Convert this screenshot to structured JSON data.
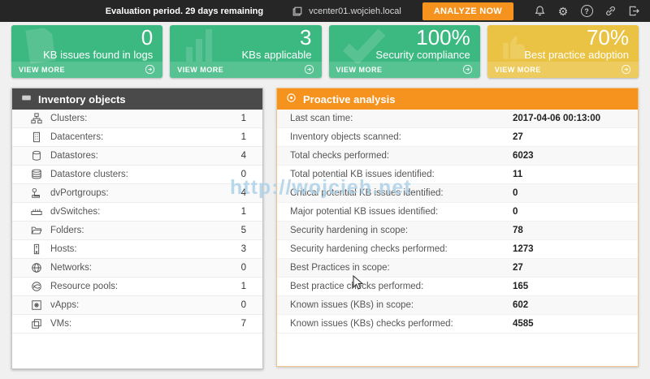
{
  "topbar": {
    "evaluation_text": "Evaluation period. 29 days remaining",
    "vcenter_host": "vcenter01.wojcieh.local",
    "analyze_button": "ANALYZE NOW",
    "icons": [
      "host-icon",
      "bell-icon",
      "gear-icon",
      "help-icon",
      "link-icon",
      "sign-out-icon"
    ]
  },
  "cards": [
    {
      "value": "0",
      "label": "KB issues found in logs",
      "view_more": "VIEW MORE",
      "color": "#3cb881",
      "bg_icon": "document-icon"
    },
    {
      "value": "3",
      "label": "KBs applicable",
      "view_more": "VIEW MORE",
      "color": "#3cb881",
      "bg_icon": "bar-chart-icon"
    },
    {
      "value": "100%",
      "label": "Security compliance",
      "view_more": "VIEW MORE",
      "color": "#3cb881",
      "bg_icon": "checkmark-icon"
    },
    {
      "value": "70%",
      "label": "Best practice adoption",
      "view_more": "VIEW MORE",
      "color": "#eac344",
      "bg_icon": "thumbs-up-icon"
    }
  ],
  "inventory": {
    "title": "Inventory objects",
    "rows": [
      {
        "icon": "clusters-icon",
        "label": "Clusters:",
        "value": "1"
      },
      {
        "icon": "datacenters-icon",
        "label": "Datacenters:",
        "value": "1"
      },
      {
        "icon": "datastores-icon",
        "label": "Datastores:",
        "value": "4"
      },
      {
        "icon": "datastore-clusters-icon",
        "label": "Datastore clusters:",
        "value": "0"
      },
      {
        "icon": "dvportgroups-icon",
        "label": "dvPortgroups:",
        "value": "4"
      },
      {
        "icon": "dvswitches-icon",
        "label": "dvSwitches:",
        "value": "1"
      },
      {
        "icon": "folders-icon",
        "label": "Folders:",
        "value": "5"
      },
      {
        "icon": "hosts-icon",
        "label": "Hosts:",
        "value": "3"
      },
      {
        "icon": "networks-icon",
        "label": "Networks:",
        "value": "0"
      },
      {
        "icon": "resource-pools-icon",
        "label": "Resource pools:",
        "value": "1"
      },
      {
        "icon": "vapps-icon",
        "label": "vApps:",
        "value": "0"
      },
      {
        "icon": "vms-icon",
        "label": "VMs:",
        "value": "7"
      }
    ]
  },
  "analysis": {
    "title": "Proactive analysis",
    "rows": [
      {
        "label": "Last scan time:",
        "value": "2017-04-06 00:13:00"
      },
      {
        "label": "Inventory objects scanned:",
        "value": "27"
      },
      {
        "label": "Total checks performed:",
        "value": "6023"
      },
      {
        "label": "Total potential KB issues identified:",
        "value": "11"
      },
      {
        "label": "Critical potential KB issues identified:",
        "value": "0"
      },
      {
        "label": "Major potential KB issues identified:",
        "value": "0"
      },
      {
        "label": "Security hardening in scope:",
        "value": "78"
      },
      {
        "label": "Security hardening checks performed:",
        "value": "1273"
      },
      {
        "label": "Best Practices in scope:",
        "value": "27"
      },
      {
        "label": "Best practice checks performed:",
        "value": "165"
      },
      {
        "label": "Known issues (KBs) in scope:",
        "value": "602"
      },
      {
        "label": "Known issues (KBs) checks performed:",
        "value": "4585"
      }
    ]
  },
  "watermark": "http://wojcieh.net",
  "colors": {
    "topbar": "#262626",
    "green": "#3cb881",
    "yellow": "#eac344",
    "orange": "#f6921e",
    "header_dark": "#4a4a4a"
  }
}
